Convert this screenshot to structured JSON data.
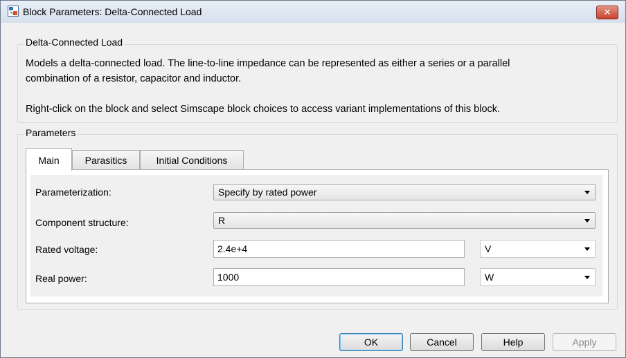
{
  "window": {
    "title": "Block Parameters: Delta-Connected Load",
    "close_glyph": "✕"
  },
  "description": {
    "group_title": "Delta-Connected Load",
    "line1": "Models a delta-connected load. The line-to-line impedance can be represented as either a series or a parallel",
    "line2": "combination of a resistor, capacitor and inductor.",
    "line3": "Right-click on the block and select Simscape block choices to access variant implementations of this block."
  },
  "parameters": {
    "group_title": "Parameters",
    "tabs": [
      {
        "label": "Main",
        "active": true
      },
      {
        "label": "Parasitics",
        "active": false
      },
      {
        "label": "Initial Conditions",
        "active": false
      }
    ],
    "fields": {
      "parameterization": {
        "label": "Parameterization:",
        "value": "Specify by rated power"
      },
      "component_structure": {
        "label": "Component structure:",
        "value": "R"
      },
      "rated_voltage": {
        "label": "Rated voltage:",
        "value": "2.4e+4",
        "unit": "V"
      },
      "real_power": {
        "label": "Real power:",
        "value": "1000",
        "unit": "W"
      }
    }
  },
  "buttons": {
    "ok": "OK",
    "cancel": "Cancel",
    "help": "Help",
    "apply": "Apply"
  }
}
